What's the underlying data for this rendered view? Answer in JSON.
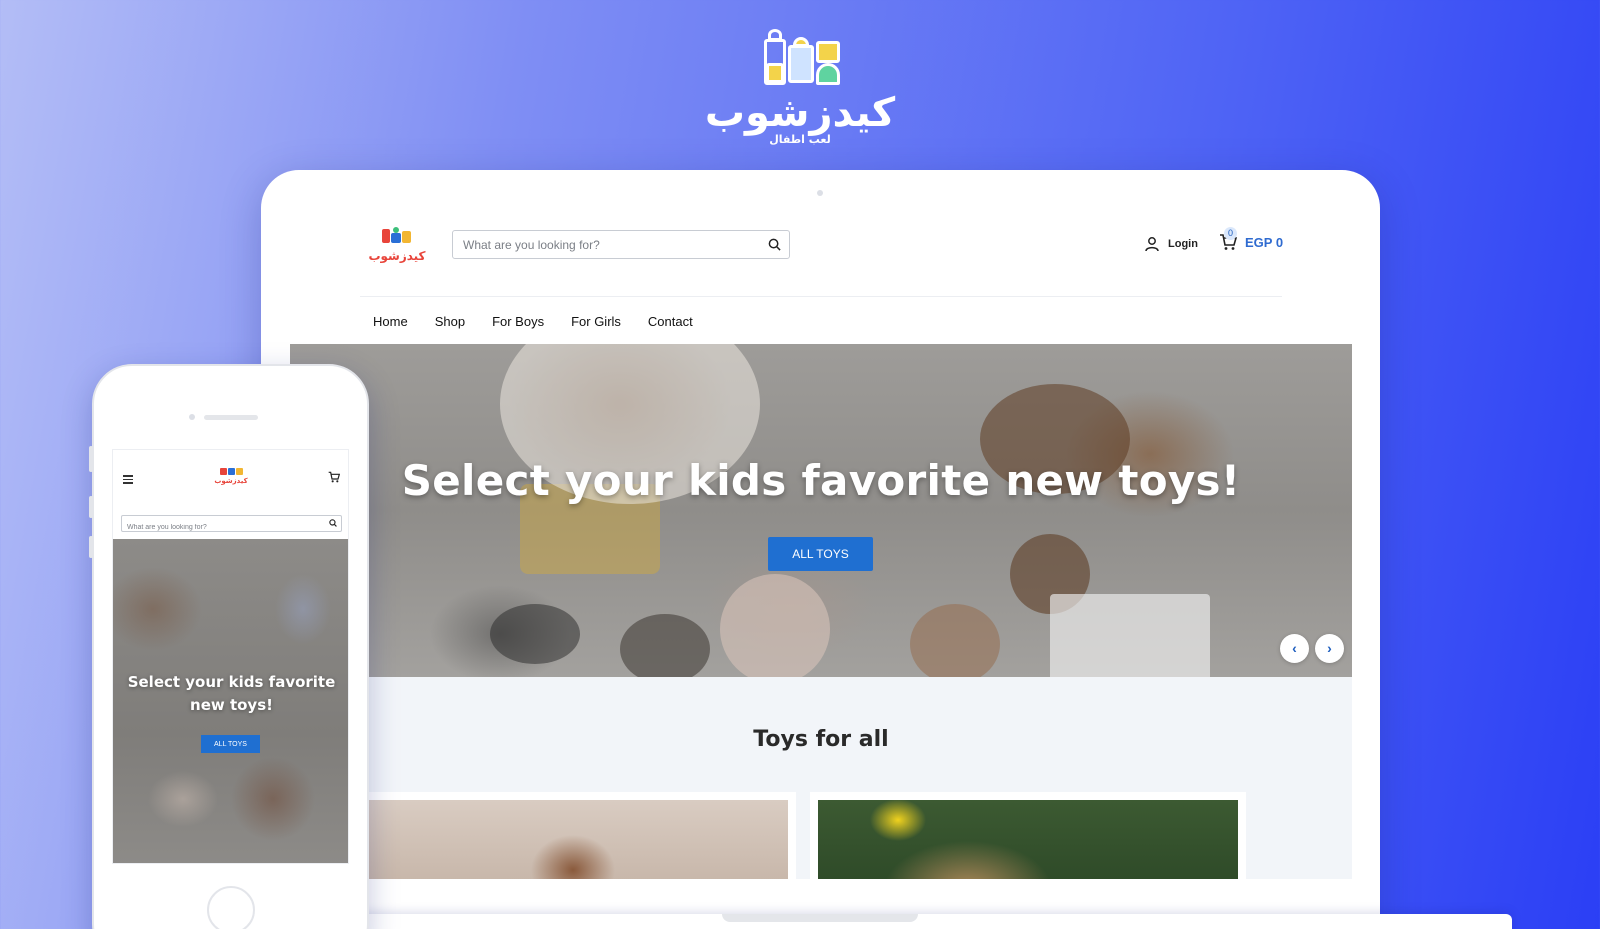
{
  "brand": {
    "name_ar": "كيدزشوب",
    "tagline_ar": "لعب اطفال"
  },
  "desktop": {
    "logo_ar": "كيدزشوب",
    "search": {
      "placeholder": "What are you looking for?"
    },
    "header": {
      "login_label": "Login",
      "cart_count": "0",
      "cart_total": "EGP 0"
    },
    "nav": {
      "items": [
        "Home",
        "Shop",
        "For Boys",
        "For Girls",
        "Contact"
      ]
    },
    "hero": {
      "title": "Select your kids favorite new toys!",
      "button_label": "ALL TOYS",
      "prev_icon": "chevron-left-icon",
      "next_icon": "chevron-right-icon"
    },
    "section": {
      "title": "Toys for all"
    }
  },
  "mobile": {
    "logo_ar": "كيدزشوب",
    "search": {
      "placeholder": "What are you looking for?"
    },
    "hero": {
      "title": "Select your kids favorite new toys!",
      "button_label": "ALL TOYS"
    }
  },
  "colors": {
    "accent": "#1f6fd1",
    "cart_text": "#2f6bd0",
    "background_left": "#b3bdf6",
    "background_right": "#2b3ff5"
  }
}
